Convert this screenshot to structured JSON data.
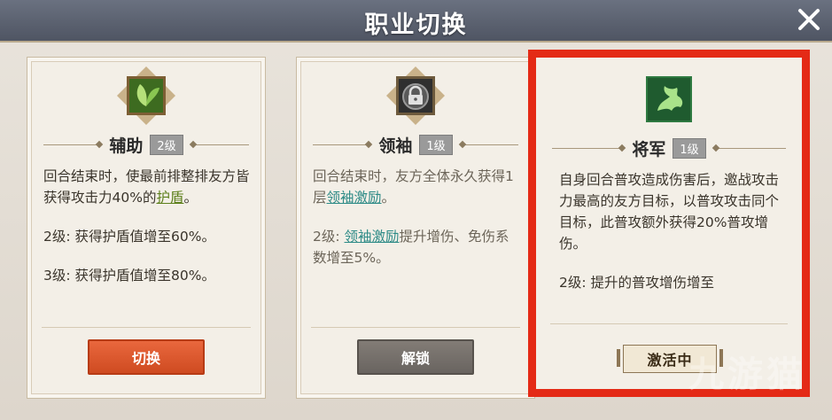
{
  "header": {
    "title": "职业切换"
  },
  "cards": [
    {
      "name": "辅助",
      "level": "2级",
      "icon": "leaf-icon",
      "text_1a": "回合结束时，使最前排整排友方皆获得攻击力40%的",
      "text_1_link": "护盾",
      "text_1b": "。",
      "text_2": "2级: 获得护盾值增至60%。",
      "text_3": "3级: 获得护盾值增至80%。",
      "button": "切换"
    },
    {
      "name": "领袖",
      "level": "1级",
      "icon": "lock-icon",
      "text_1a": "回合结束时，友方全体永久获得1层",
      "text_1_link": "领袖激励",
      "text_1b": "。",
      "text_2a": "2级: ",
      "text_2_link": "领袖激励",
      "text_2b": "提升增伤、免伤系数增至5%。",
      "button": "解锁"
    },
    {
      "name": "将军",
      "level": "1级",
      "icon": "dragon-icon",
      "text_1": "自身回合普攻造成伤害后，邀战攻击力最高的友方目标，以普攻攻击同个目标，此普攻额外获得20%普攻增伤。",
      "text_2": "2级: 提升的普攻增伤增至",
      "status": "激活中"
    }
  ],
  "watermark": "九游猫",
  "colors": {
    "highlight": "#e42a16",
    "switch_button": "#d95a2e",
    "unlock_button": "#76706b",
    "shield_link": "#5c7f1b",
    "leader_link": "#2c8a86"
  }
}
